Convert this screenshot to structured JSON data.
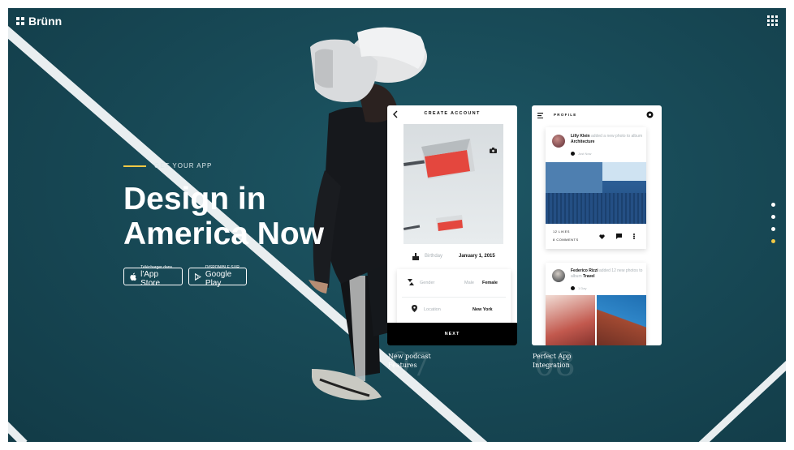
{
  "brand": {
    "name": "Brünn"
  },
  "hero": {
    "eyebrow": "GET YOUR APP",
    "headline": "Design in\nAmerica Now",
    "appstore": {
      "small": "Télécharger dans",
      "big": "l'App Store"
    },
    "googleplay": {
      "small": "DISPONIBLE SUR",
      "big": "Google Play"
    }
  },
  "card1": {
    "title": "CREATE ACCOUNT",
    "birthday_label": "Birthday",
    "birthday_value": "January 1, 2015",
    "gender_label": "Gender",
    "gender_male": "Male",
    "gender_female": "Female",
    "location_label": "Location",
    "location_value": "New York",
    "next": "NEXT",
    "caption": "New podcast\nFeatures",
    "number": "07"
  },
  "card2": {
    "title": "PROFILE",
    "post1": {
      "name": "Lilly Klein",
      "text": "added a new photo to album",
      "album": "Architecture",
      "time": "Just Now",
      "likes": "12 LIKES",
      "comments": "8 COMMENTS"
    },
    "post2": {
      "name": "Federico Rizzi",
      "text": "added 12 new photos to album",
      "album": "Travel",
      "time": "1 Day"
    },
    "caption": "Perfect App\nIntegration",
    "number": "08"
  },
  "colors": {
    "accent": "#f1c945",
    "background": "#184a57"
  },
  "nav_dots": {
    "count": 4,
    "active_index": 3
  }
}
